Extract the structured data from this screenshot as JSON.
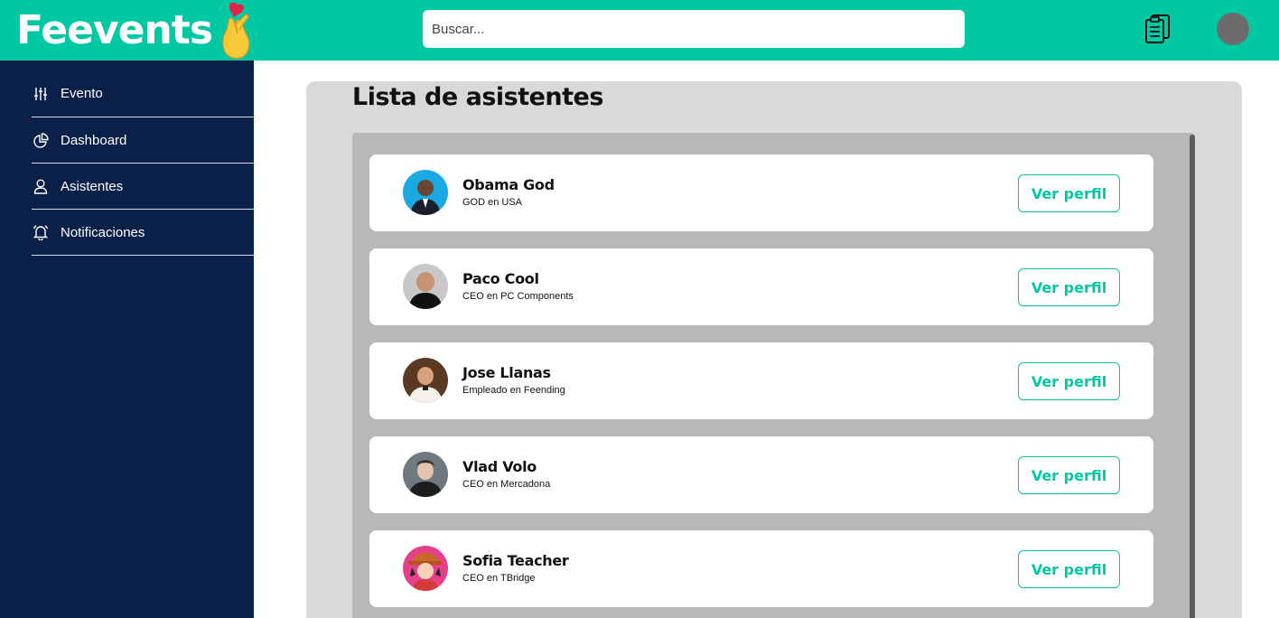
{
  "header": {
    "logo_text": "Feevents",
    "search_placeholder": "Buscar...",
    "brand_color": "#00c8a3"
  },
  "sidebar": {
    "background": "#0b2048",
    "items": [
      {
        "label": "Evento",
        "icon": "sliders-icon"
      },
      {
        "label": "Dashboard",
        "icon": "pie-chart-icon"
      },
      {
        "label": "Asistentes",
        "icon": "user-icon"
      },
      {
        "label": "Notificaciones",
        "icon": "bell-icon"
      }
    ]
  },
  "main": {
    "title": "Lista de asistentes",
    "attendees": [
      {
        "name": "Obama God",
        "role": "GOD en USA",
        "button": "Ver perfil"
      },
      {
        "name": "Paco Cool",
        "role": "CEO en PC Components",
        "button": "Ver perfil"
      },
      {
        "name": "Jose Llanas",
        "role": "Empleado en Feending",
        "button": "Ver perfil"
      },
      {
        "name": "Vlad Volo",
        "role": "CEO en Mercadona",
        "button": "Ver perfil"
      },
      {
        "name": "Sofia Teacher",
        "role": "CEO en TBridge",
        "button": "Ver perfil"
      }
    ]
  }
}
